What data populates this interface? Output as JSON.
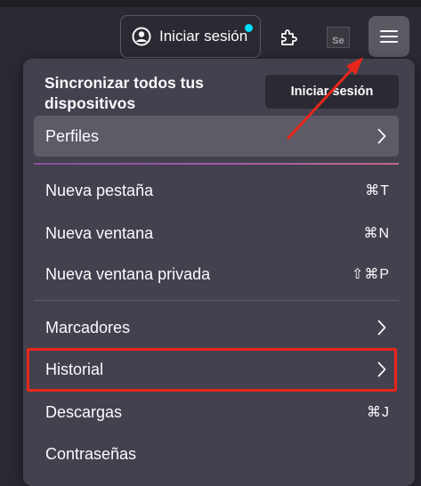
{
  "toolbar": {
    "signin_label": "Iniciar sesión",
    "account_icon": "account-circle-icon",
    "extensions_icon": "puzzle-piece-icon",
    "extension_se_label": "Se",
    "menu_icon": "hamburger-menu-icon"
  },
  "panel": {
    "sync_title": "Sincronizar todos tus dispositivos",
    "signin_button": "Iniciar sesión",
    "profiles": {
      "label": "Perfiles"
    },
    "items": [
      {
        "label": "Nueva pestaña",
        "shortcut": "⌘T"
      },
      {
        "label": "Nueva ventana",
        "shortcut": "⌘N"
      },
      {
        "label": "Nueva ventana privada",
        "shortcut": "⇧⌘P"
      },
      {
        "label": "Marcadores"
      },
      {
        "label": "Historial"
      },
      {
        "label": "Descargas",
        "shortcut": "⌘J"
      },
      {
        "label": "Contraseñas"
      }
    ]
  },
  "colors": {
    "annotation_red": "#e8251a",
    "panel_bg": "#42414d",
    "toolbar_bg": "#2b2a33",
    "notification_dot": "#00ddff"
  }
}
